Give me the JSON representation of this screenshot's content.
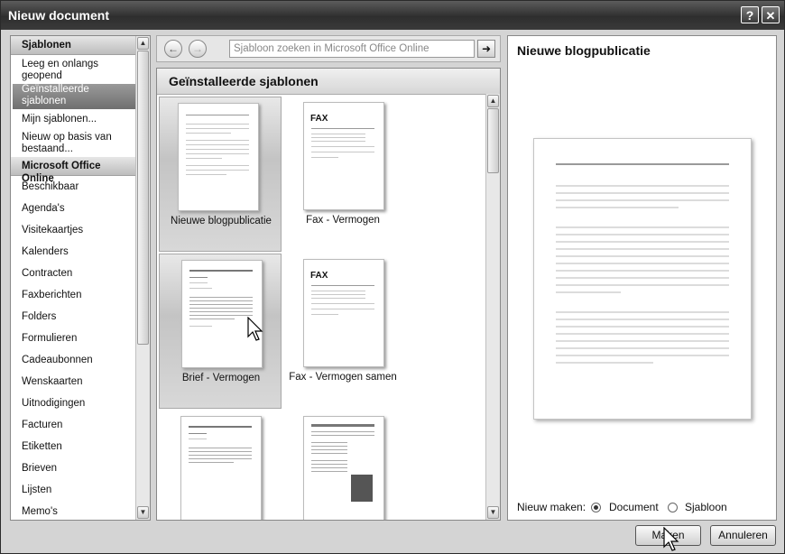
{
  "window": {
    "title": "Nieuw document",
    "help_glyph": "?",
    "close_glyph": "✕"
  },
  "sidebar": {
    "header_sjablonen": "Sjablonen",
    "items_top": [
      {
        "label": "Leeg en onlangs geopend",
        "selected": false
      },
      {
        "label": "Geïnstalleerde sjablonen",
        "selected": true
      },
      {
        "label": "Mijn sjablonen...",
        "selected": false
      },
      {
        "label": "Nieuw op basis van bestaand...",
        "selected": false
      }
    ],
    "header_online": "Microsoft Office Online",
    "items_online": [
      "Beschikbaar",
      "Agenda's",
      "Visitekaartjes",
      "Kalenders",
      "Contracten",
      "Faxberichten",
      "Folders",
      "Formulieren",
      "Cadeaubonnen",
      "Wenskaarten",
      "Uitnodigingen",
      "Facturen",
      "Etiketten",
      "Brieven",
      "Lijsten",
      "Memo's"
    ]
  },
  "toolbar": {
    "back_icon": "back-arrow-icon",
    "forward_icon": "forward-arrow-icon",
    "search_placeholder": "Sjabloon zoeken in Microsoft Office Online",
    "go_icon": "go-arrow-icon"
  },
  "main": {
    "heading": "Geïnstalleerde sjablonen",
    "templates": [
      {
        "label": "Nieuwe blogpublicatie",
        "selected": true
      },
      {
        "label": "Fax - Vermogen",
        "selected": false,
        "thumb_text": "FAX"
      },
      {
        "label": "Brief - Vermogen",
        "selected": true
      },
      {
        "label": "Fax - Vermogen samen",
        "selected": false,
        "thumb_text": "FAX"
      },
      {
        "label": "",
        "selected": false
      },
      {
        "label": "",
        "selected": false
      }
    ]
  },
  "preview": {
    "title": "Nieuwe blogpublicatie",
    "create_label": "Nieuw maken:",
    "options": [
      {
        "label": "Document",
        "checked": true
      },
      {
        "label": "Sjabloon",
        "checked": false
      }
    ]
  },
  "buttons": {
    "create": "Maken",
    "cancel": "Annuleren"
  },
  "colors": {
    "titlebar": "#3a3a3a",
    "selection": "#7a7a7a"
  }
}
